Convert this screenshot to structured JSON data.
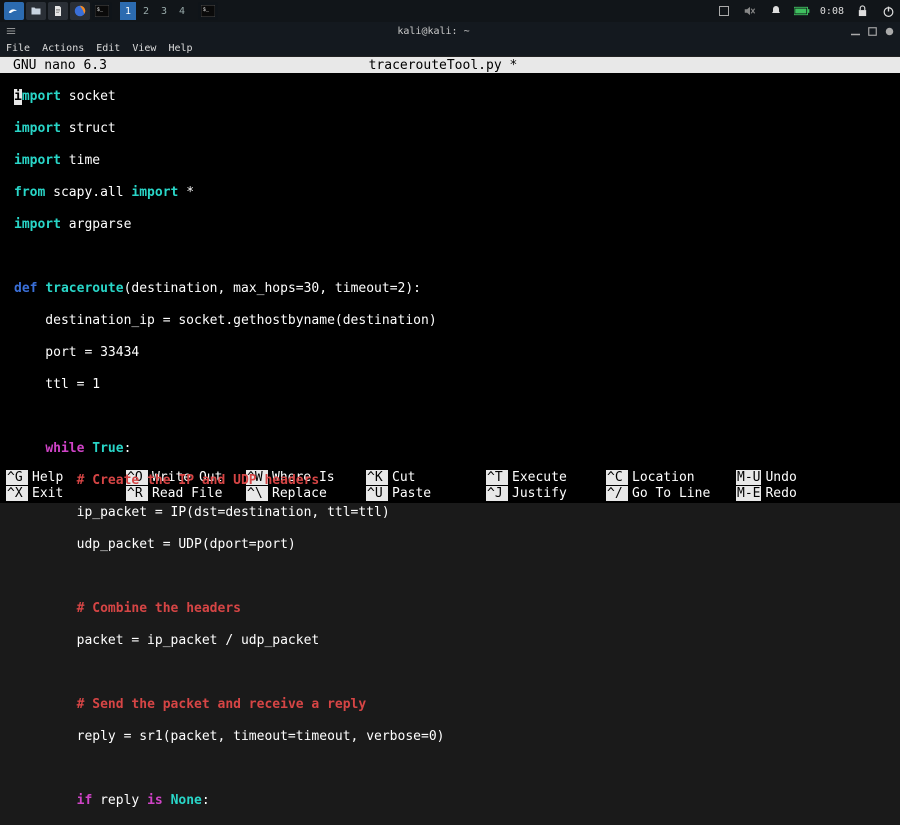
{
  "panel": {
    "workspaces": [
      "1",
      "2",
      "3",
      "4"
    ],
    "clock": "0:08"
  },
  "window": {
    "title": "kali@kali: ~"
  },
  "menubar": {
    "items": [
      "File",
      "Actions",
      "Edit",
      "View",
      "Help"
    ]
  },
  "nano": {
    "version": "GNU nano 6.3",
    "filename": "tracerouteTool.py *"
  },
  "shortcuts": {
    "row1": [
      {
        "k": "^G",
        "l": "Help"
      },
      {
        "k": "^O",
        "l": "Write Out"
      },
      {
        "k": "^W",
        "l": "Where Is"
      },
      {
        "k": "^K",
        "l": "Cut"
      },
      {
        "k": "^T",
        "l": "Execute"
      },
      {
        "k": "^C",
        "l": "Location"
      },
      {
        "k": "M-U",
        "l": "Undo"
      }
    ],
    "row2": [
      {
        "k": "^X",
        "l": "Exit"
      },
      {
        "k": "^R",
        "l": "Read File"
      },
      {
        "k": "^\\",
        "l": "Replace"
      },
      {
        "k": "^U",
        "l": "Paste"
      },
      {
        "k": "^J",
        "l": "Justify"
      },
      {
        "k": "^/",
        "l": "Go To Line"
      },
      {
        "k": "M-E",
        "l": "Redo"
      }
    ]
  },
  "code": {
    "l1a": "i",
    "l1b": "mport",
    "l1c": " socket",
    "l2a": "import",
    "l2b": " struct",
    "l3a": "import",
    "l3b": " time",
    "l4a": "from",
    "l4b": " scapy.all ",
    "l4c": "import",
    "l4d": " *",
    "l5a": "import",
    "l5b": " argparse",
    "l7a": "def ",
    "l7b": "traceroute",
    "l7c": "(destination, max_hops=30, timeout=2):",
    "l8": "    destination_ip = socket.gethostbyname(destination)",
    "l9": "    port = 33434",
    "l10": "    ttl = 1",
    "l12a": "    ",
    "l12b": "while ",
    "l12c": "True",
    "l12d": ":",
    "l13a": "        ",
    "l13b": "# Create the IP and UDP headers",
    "l14": "        ip_packet = IP(dst=destination, ttl=ttl)",
    "l15": "        udp_packet = UDP(dport=port)",
    "l17a": "        ",
    "l17b": "# Combine the headers",
    "l18": "        packet = ip_packet / udp_packet",
    "l20a": "        ",
    "l20b": "# Send the packet and receive a reply",
    "l21": "        reply = sr1(packet, timeout=timeout, verbose=0)",
    "l23a": "        ",
    "l23b": "if",
    "l23c": " reply ",
    "l23d": "is ",
    "l23e": "None",
    "l23f": ":"
  }
}
